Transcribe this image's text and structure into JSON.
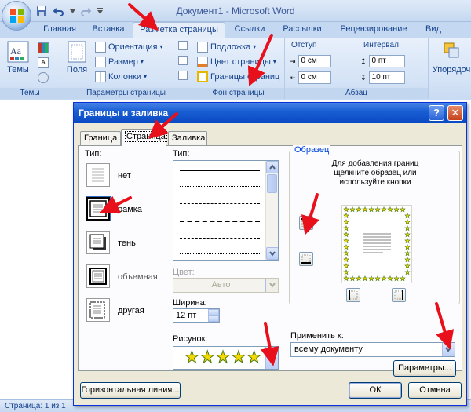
{
  "window": {
    "title": "Документ1 - Microsoft Word"
  },
  "ribbon": {
    "tabs": [
      "Главная",
      "Вставка",
      "Разметка страницы",
      "Ссылки",
      "Рассылки",
      "Рецензирование",
      "Вид"
    ],
    "active_tab": "Разметка страницы",
    "groups": {
      "themes": {
        "label": "Темы",
        "themes_button": "Темы"
      },
      "page_setup": {
        "label": "Параметры страницы",
        "margins_button": "Поля",
        "orientation": "Ориентация",
        "size": "Размер",
        "columns": "Колонки"
      },
      "page_background": {
        "label": "Фон страницы",
        "watermark": "Подложка",
        "page_color": "Цвет страницы",
        "page_borders": "Границы страниц"
      },
      "paragraph": {
        "label": "Абзац",
        "indent_label": "Отступ",
        "indent_left": "0 см",
        "indent_right": "0 см",
        "spacing_label": "Интервал",
        "spacing_before": "0 пт",
        "spacing_after": "10 пт"
      },
      "arrange": {
        "label": "Упорядоч"
      }
    }
  },
  "status_bar": {
    "page_info": "Страница: 1 из 1"
  },
  "dialog": {
    "title": "Границы и заливка",
    "help_glyph": "?",
    "close_glyph": "✕",
    "tabs": [
      "Граница",
      "Страница",
      "Заливка"
    ],
    "active_tab": "Страница",
    "setting": {
      "label": "Тип:",
      "options": [
        "нет",
        "рамка",
        "тень",
        "объемная",
        "другая"
      ],
      "selected": "рамка"
    },
    "style": {
      "label": "Тип:"
    },
    "color": {
      "label": "Цвет:",
      "value": "Авто"
    },
    "width": {
      "label": "Ширина:",
      "value": "12 пт"
    },
    "art": {
      "label": "Рисунок:",
      "stars": "★★★★★"
    },
    "preview": {
      "label": "Образец",
      "hint": "Для добавления границ щелкните образец или используйте кнопки"
    },
    "apply_to": {
      "label": "Применить к:",
      "value": "всему документу"
    },
    "buttons": {
      "options": "Параметры...",
      "horizontal_line": "Горизонтальная линия...",
      "ok": "ОК",
      "cancel": "Отмена"
    }
  },
  "colors": {
    "ribbon_text": "#15428b",
    "dialog_title_bar": "#0a49c2",
    "dialog_body": "#ece9d8",
    "annotation_arrow": "#e8101a",
    "star_fill": "#f5d800",
    "star_border": "#4c7a12"
  }
}
